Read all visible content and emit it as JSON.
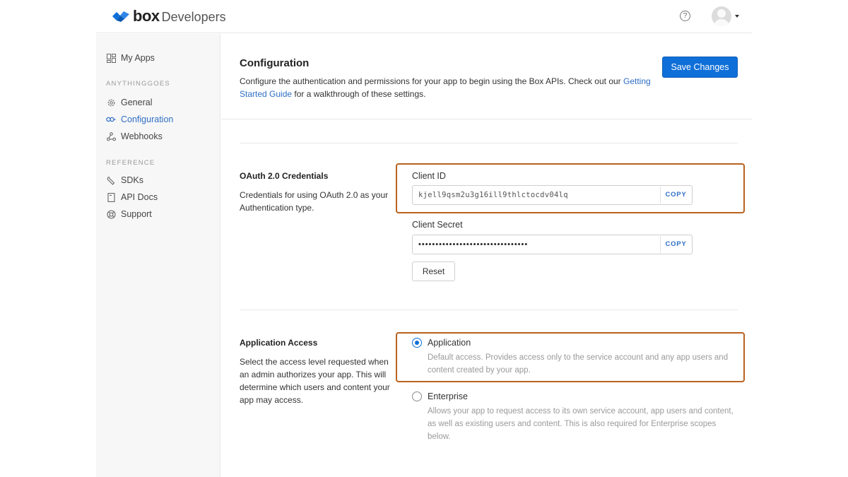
{
  "header": {
    "logo_word": "box",
    "logo_suffix": "Developers",
    "help_glyph": "?",
    "help_icon": "help-circle-icon",
    "avatar_icon": "user-avatar-icon"
  },
  "sidebar": {
    "my_apps": {
      "label": "My Apps",
      "icon": "grid-icon"
    },
    "section_app": "ANYTHINGGOES",
    "app_items": [
      {
        "label": "General",
        "icon": "gear-icon",
        "active": false
      },
      {
        "label": "Configuration",
        "icon": "key-icon",
        "active": true
      },
      {
        "label": "Webhooks",
        "icon": "webhook-icon",
        "active": false
      }
    ],
    "section_reference": "REFERENCE",
    "reference_items": [
      {
        "label": "SDKs",
        "icon": "wrench-icon"
      },
      {
        "label": "API Docs",
        "icon": "document-icon"
      },
      {
        "label": "Support",
        "icon": "lifebuoy-icon"
      }
    ]
  },
  "main": {
    "title": "Configuration",
    "description_before_link": "Configure the authentication and permissions for your app to begin using the Box APIs. Check out our ",
    "description_link": "Getting Started Guide",
    "description_after_link": " for a walkthrough of these settings.",
    "save_button": "Save Changes"
  },
  "oauth": {
    "title": "OAuth 2.0 Credentials",
    "description": "Credentials for using OAuth 2.0 as your Authentication type.",
    "client_id_label": "Client ID",
    "client_id_value": "kjell9qsm2u3g16ill9thlctocdv04lq",
    "client_secret_label": "Client Secret",
    "client_secret_value": "••••••••••••••••••••••••••••••••",
    "copy_label": "COPY",
    "reset_button": "Reset"
  },
  "access": {
    "title": "Application Access",
    "description": "Select the access level requested when an admin authorizes your app. This will determine which users and content your app may access.",
    "options": [
      {
        "label": "Application",
        "description": "Default access. Provides access only to the service account and any app users and content created by your app.",
        "selected": true
      },
      {
        "label": "Enterprise",
        "description": "Allows your app to request access to its own service account, app users and content, as well as existing users and content. This is also required for Enterprise scopes below.",
        "selected": false
      }
    ]
  },
  "colors": {
    "accent": "#0f6fd8",
    "link": "#2f6fc5",
    "highlight_border": "#b9621f",
    "sidebar_bg": "#f7f7f7"
  }
}
